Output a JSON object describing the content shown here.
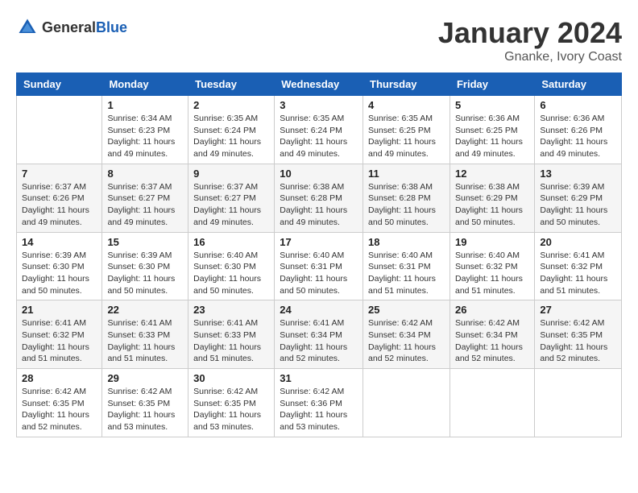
{
  "header": {
    "logo_general": "General",
    "logo_blue": "Blue",
    "month_title": "January 2024",
    "location": "Gnanke, Ivory Coast"
  },
  "weekdays": [
    "Sunday",
    "Monday",
    "Tuesday",
    "Wednesday",
    "Thursday",
    "Friday",
    "Saturday"
  ],
  "weeks": [
    [
      {
        "day": "",
        "info": ""
      },
      {
        "day": "1",
        "info": "Sunrise: 6:34 AM\nSunset: 6:23 PM\nDaylight: 11 hours\nand 49 minutes."
      },
      {
        "day": "2",
        "info": "Sunrise: 6:35 AM\nSunset: 6:24 PM\nDaylight: 11 hours\nand 49 minutes."
      },
      {
        "day": "3",
        "info": "Sunrise: 6:35 AM\nSunset: 6:24 PM\nDaylight: 11 hours\nand 49 minutes."
      },
      {
        "day": "4",
        "info": "Sunrise: 6:35 AM\nSunset: 6:25 PM\nDaylight: 11 hours\nand 49 minutes."
      },
      {
        "day": "5",
        "info": "Sunrise: 6:36 AM\nSunset: 6:25 PM\nDaylight: 11 hours\nand 49 minutes."
      },
      {
        "day": "6",
        "info": "Sunrise: 6:36 AM\nSunset: 6:26 PM\nDaylight: 11 hours\nand 49 minutes."
      }
    ],
    [
      {
        "day": "7",
        "info": "Sunrise: 6:37 AM\nSunset: 6:26 PM\nDaylight: 11 hours\nand 49 minutes."
      },
      {
        "day": "8",
        "info": "Sunrise: 6:37 AM\nSunset: 6:27 PM\nDaylight: 11 hours\nand 49 minutes."
      },
      {
        "day": "9",
        "info": "Sunrise: 6:37 AM\nSunset: 6:27 PM\nDaylight: 11 hours\nand 49 minutes."
      },
      {
        "day": "10",
        "info": "Sunrise: 6:38 AM\nSunset: 6:28 PM\nDaylight: 11 hours\nand 49 minutes."
      },
      {
        "day": "11",
        "info": "Sunrise: 6:38 AM\nSunset: 6:28 PM\nDaylight: 11 hours\nand 50 minutes."
      },
      {
        "day": "12",
        "info": "Sunrise: 6:38 AM\nSunset: 6:29 PM\nDaylight: 11 hours\nand 50 minutes."
      },
      {
        "day": "13",
        "info": "Sunrise: 6:39 AM\nSunset: 6:29 PM\nDaylight: 11 hours\nand 50 minutes."
      }
    ],
    [
      {
        "day": "14",
        "info": "Sunrise: 6:39 AM\nSunset: 6:30 PM\nDaylight: 11 hours\nand 50 minutes."
      },
      {
        "day": "15",
        "info": "Sunrise: 6:39 AM\nSunset: 6:30 PM\nDaylight: 11 hours\nand 50 minutes."
      },
      {
        "day": "16",
        "info": "Sunrise: 6:40 AM\nSunset: 6:30 PM\nDaylight: 11 hours\nand 50 minutes."
      },
      {
        "day": "17",
        "info": "Sunrise: 6:40 AM\nSunset: 6:31 PM\nDaylight: 11 hours\nand 50 minutes."
      },
      {
        "day": "18",
        "info": "Sunrise: 6:40 AM\nSunset: 6:31 PM\nDaylight: 11 hours\nand 51 minutes."
      },
      {
        "day": "19",
        "info": "Sunrise: 6:40 AM\nSunset: 6:32 PM\nDaylight: 11 hours\nand 51 minutes."
      },
      {
        "day": "20",
        "info": "Sunrise: 6:41 AM\nSunset: 6:32 PM\nDaylight: 11 hours\nand 51 minutes."
      }
    ],
    [
      {
        "day": "21",
        "info": "Sunrise: 6:41 AM\nSunset: 6:32 PM\nDaylight: 11 hours\nand 51 minutes."
      },
      {
        "day": "22",
        "info": "Sunrise: 6:41 AM\nSunset: 6:33 PM\nDaylight: 11 hours\nand 51 minutes."
      },
      {
        "day": "23",
        "info": "Sunrise: 6:41 AM\nSunset: 6:33 PM\nDaylight: 11 hours\nand 51 minutes."
      },
      {
        "day": "24",
        "info": "Sunrise: 6:41 AM\nSunset: 6:34 PM\nDaylight: 11 hours\nand 52 minutes."
      },
      {
        "day": "25",
        "info": "Sunrise: 6:42 AM\nSunset: 6:34 PM\nDaylight: 11 hours\nand 52 minutes."
      },
      {
        "day": "26",
        "info": "Sunrise: 6:42 AM\nSunset: 6:34 PM\nDaylight: 11 hours\nand 52 minutes."
      },
      {
        "day": "27",
        "info": "Sunrise: 6:42 AM\nSunset: 6:35 PM\nDaylight: 11 hours\nand 52 minutes."
      }
    ],
    [
      {
        "day": "28",
        "info": "Sunrise: 6:42 AM\nSunset: 6:35 PM\nDaylight: 11 hours\nand 52 minutes."
      },
      {
        "day": "29",
        "info": "Sunrise: 6:42 AM\nSunset: 6:35 PM\nDaylight: 11 hours\nand 53 minutes."
      },
      {
        "day": "30",
        "info": "Sunrise: 6:42 AM\nSunset: 6:35 PM\nDaylight: 11 hours\nand 53 minutes."
      },
      {
        "day": "31",
        "info": "Sunrise: 6:42 AM\nSunset: 6:36 PM\nDaylight: 11 hours\nand 53 minutes."
      },
      {
        "day": "",
        "info": ""
      },
      {
        "day": "",
        "info": ""
      },
      {
        "day": "",
        "info": ""
      }
    ]
  ]
}
